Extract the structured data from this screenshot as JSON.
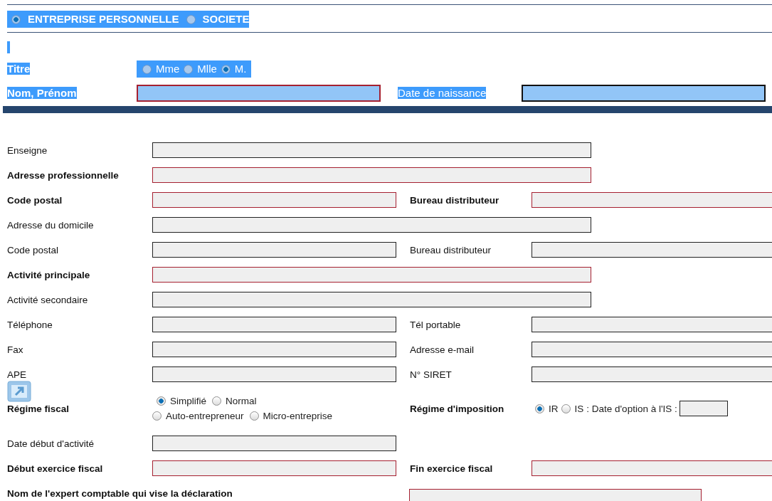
{
  "entity_type": [
    {
      "label": "ENTREPRISE PERSONNELLE",
      "selected": true
    },
    {
      "label": "SOCIETE",
      "selected": false
    }
  ],
  "titre": {
    "label": "Titre",
    "options": [
      {
        "label": "Mme",
        "selected": false
      },
      {
        "label": "Mlle",
        "selected": false
      },
      {
        "label": "M.",
        "selected": true
      }
    ]
  },
  "identity": {
    "name_label": "Nom, Prénom",
    "birth_label": "Date de naissance"
  },
  "rows": [
    {
      "kind": "full",
      "label": "Enseigne",
      "required": false
    },
    {
      "kind": "full",
      "label": "Adresse professionnelle",
      "required": true
    },
    {
      "kind": "pair",
      "label": "Code postal",
      "required": true,
      "right_label": "Bureau distributeur",
      "right_required": true
    },
    {
      "kind": "full",
      "label": "Adresse du domicile",
      "required": false
    },
    {
      "kind": "pair",
      "label": "Code postal",
      "required": false,
      "right_label": "Bureau distributeur",
      "right_required": false
    },
    {
      "kind": "full",
      "label": "Activité principale",
      "required": true
    },
    {
      "kind": "full",
      "label": "Activité secondaire",
      "required": false
    },
    {
      "kind": "pair",
      "label": "Téléphone",
      "required": false,
      "right_label": "Tél portable",
      "right_required": false
    },
    {
      "kind": "pair",
      "label": "Fax",
      "required": false,
      "right_label": "Adresse e-mail",
      "right_required": false
    },
    {
      "kind": "pair",
      "label": "APE",
      "required": false,
      "right_label": "N° SIRET",
      "right_required": false,
      "has_link_icon": true
    },
    {
      "kind": "regime",
      "label": "Régime fiscal",
      "required": true,
      "options": [
        {
          "label": "Simplifié",
          "selected": true
        },
        {
          "label": "Normal",
          "selected": false
        },
        {
          "label": "Auto-entrepreneur",
          "selected": false
        },
        {
          "label": "Micro-entreprise",
          "selected": false
        }
      ],
      "right_label": "Régime d'imposition",
      "right_required": true,
      "right_options": [
        {
          "label": "IR",
          "selected": true
        },
        {
          "label": "IS",
          "selected": false
        }
      ],
      "option_date_label": ": Date d'option à l'IS :"
    },
    {
      "kind": "half",
      "label": "Date début d'activité",
      "required": false
    },
    {
      "kind": "pair",
      "label": "Début exercice fiscal",
      "required": true,
      "right_label": "Fin exercice fiscal",
      "right_required": true
    },
    {
      "kind": "expert",
      "label": "Nom de l'expert comptable qui vise la déclaration",
      "required": true
    }
  ]
}
